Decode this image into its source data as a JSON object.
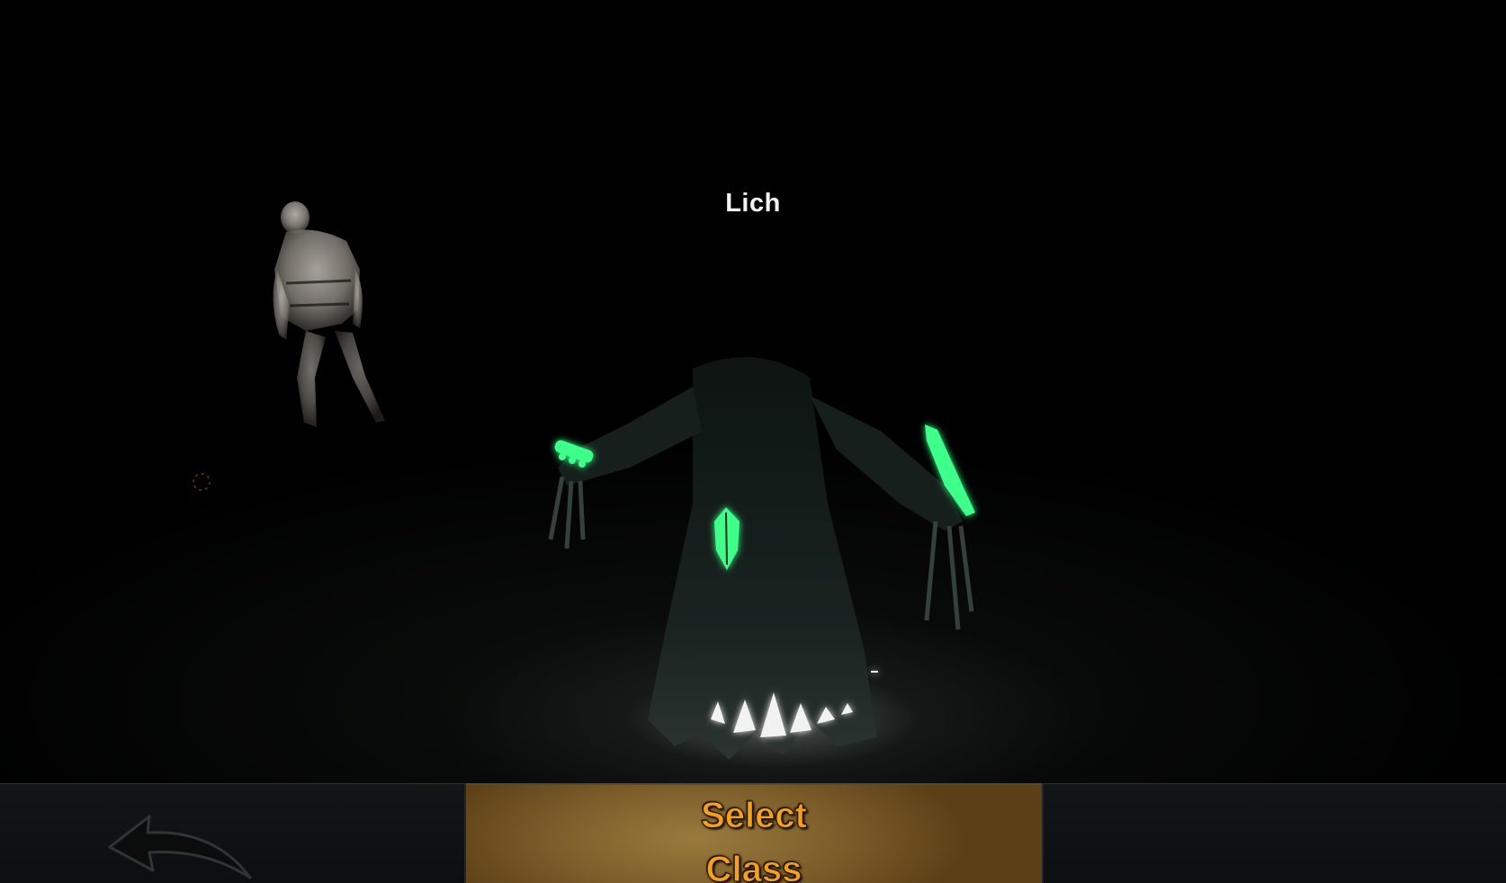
{
  "scene": {
    "character_name": "Lich"
  },
  "controls": {
    "select_button_label": "Select\nClass",
    "prev_icon": "curved-arrow-left-icon",
    "next_icon": "curved-arrow-right-icon"
  },
  "colors": {
    "select_text": "#f5a11e",
    "select_bg": "#7b5d2a",
    "glow_green": "#3cff8a",
    "name_text": "#f2f2f2"
  }
}
